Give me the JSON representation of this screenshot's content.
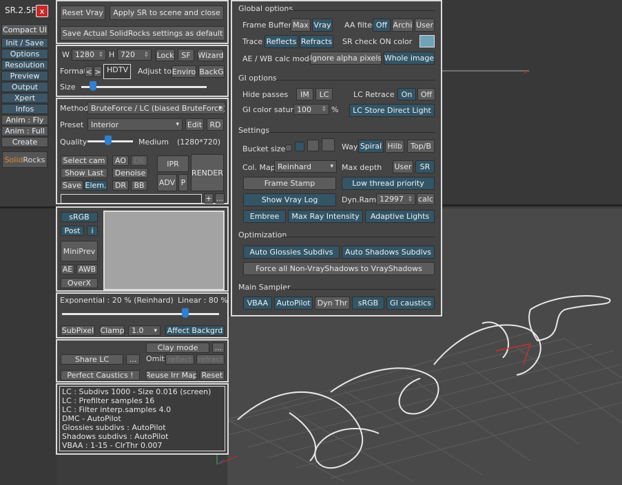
{
  "app": {
    "title": "SR.2.5F",
    "close": "x"
  },
  "left_menu": [
    "Compact UI",
    "Init / Save",
    "Options",
    "Resolution",
    "Preview",
    "Output",
    "Xpert",
    "Infos",
    "Anim : Fly",
    "Anim : Full",
    "Create"
  ],
  "logo": {
    "solid": "Solid",
    "rocks": "Rocks"
  },
  "top": {
    "reset": "Reset Vray",
    "apply": "Apply SR to scene and close",
    "save_default": ">> Save Actual SolidRocks settings as default <<"
  },
  "res": {
    "w_label": "W",
    "w": "1280",
    "h_label": "H",
    "h": "720",
    "lock": "Lock",
    "sf": "SF",
    "wizard": "Wizard",
    "format_label": "Format",
    "prev": "<",
    "next": ">",
    "format": "HDTV",
    "adjust_label": "Adjust to",
    "enviro": "Enviro",
    "backg": "BackG",
    "size_label": "Size"
  },
  "method": {
    "label": "Method",
    "value": "BruteForce / LC (biased BruteForce)",
    "preset_label": "Preset",
    "preset": "Interior",
    "edit": "Edit",
    "rd": "RD",
    "quality_label": "Quality",
    "quality": "Medium",
    "quality_res": "(1280*720)"
  },
  "render": {
    "select_cam": "Select cam",
    "ao": "AO",
    "de": "DE",
    "ipr": "IPR",
    "show_last": "Show Last",
    "denoise": "Denoise",
    "render": "RENDER",
    "adv": "ADV",
    "p": "P",
    "save": "Save",
    "elem": "Elem.",
    "dr": "DR",
    "bb": "BB",
    "plus": "+",
    "more": "..."
  },
  "post": {
    "srgb": "sRGB",
    "post": "Post",
    "i": "i",
    "miniprev": "MiniPrev",
    "ae": "AE",
    "awb": "AWB",
    "overx": "OverX"
  },
  "exp": {
    "left": "Exponential : 20 %  (Reinhard)",
    "right": "Linear : 80 %",
    "subpixel": "SubPixel",
    "clamp": "Clamp",
    "clamp_val": "1.0",
    "affect": "Affect Backgrd"
  },
  "misc": {
    "clay": "Clay mode",
    "more": "...",
    "share_lc": "Share LC",
    "omit": "Omit :",
    "reflect": "reflect",
    "refract": "refract",
    "caustics": "Perfect Caustics !",
    "reuse": "Reuse Irr Map",
    "reset": "Reset"
  },
  "info_lines": [
    "LC : Subdivs 1000 - Size 0.016 (screen)",
    "LC : Prefilter samples 16",
    "LC : Filter interp.samples  4.0",
    "DMC - AutoPilot",
    "Glossies subdivs : AutoPilot",
    "Shadows subdivs : AutoPilot",
    "VBAA : 1-15 - ClrThr 0.007"
  ],
  "global": {
    "title": "Global options",
    "fb_label": "Frame Buffer",
    "max": "Max",
    "vray": "Vray",
    "aa_label": "AA filter",
    "off": "Off",
    "archi": "Archi",
    "user": "User",
    "trace_label": "Trace",
    "reflects": "Reflects",
    "refracts": "Refracts",
    "sr_check": "SR check ON color",
    "aewb_label": "AE / WB calc mode",
    "ignore_alpha": "Ignore alpha pixels",
    "whole": "Whole image",
    "check_color": "#6fa3b8"
  },
  "gi": {
    "title": "GI options",
    "hide_label": "Hide passes",
    "im": "IM",
    "lc": "LC",
    "retrace_label": "LC Retrace",
    "on": "On",
    "off": "Off",
    "satur_label": "GI color satur.",
    "satur": "100",
    "pct": "%",
    "lc_store": "LC Store Direct Light"
  },
  "settings": {
    "title": "Settings",
    "bucket_label": "Bucket size",
    "way_label": "Way",
    "spiral": "Spiral",
    "hilb": "Hilb",
    "topb": "Top/B",
    "colmap_label": "Col. Map",
    "colmap": "Reinhard",
    "maxdepth_label": "Max depth",
    "user": "User",
    "sr": "SR",
    "frame_stamp": "Frame Stamp",
    "low_thread": "Low thread priority",
    "show_log": "Show Vray Log",
    "dynram_label": "Dyn.Ram",
    "dynram": "12997",
    "calc": "calc",
    "embree": "Embree",
    "max_ray": "Max Ray Intensity",
    "adaptive": "Adaptive Lights"
  },
  "opt": {
    "title": "Optimization",
    "auto_gloss": "Auto Glossies Subdivs",
    "auto_shadow": "Auto Shadows Subdivs",
    "force": "Force all Non-VrayShadows to VrayShadows"
  },
  "sampler": {
    "title": "Main Sampler",
    "vbaa": "VBAA",
    "autopilot": "AutoPilot",
    "dynthr": "Dyn Thr",
    "srgb": "sRGB",
    "gi_caustics": "GI caustics"
  }
}
